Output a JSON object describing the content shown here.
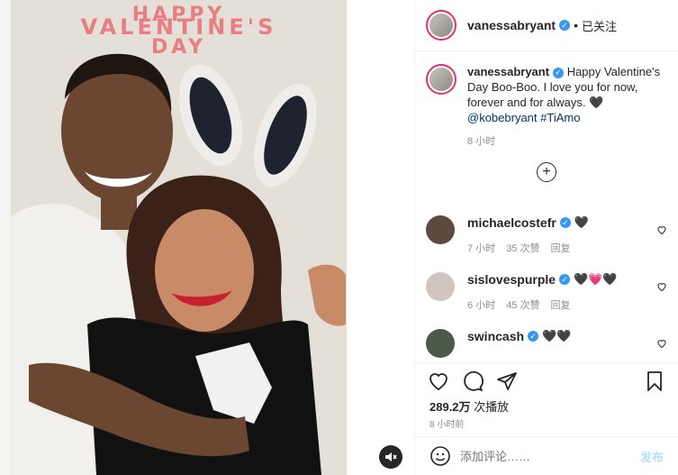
{
  "media": {
    "photo_text": {
      "line1": "HAPPY",
      "line2": "VALENTINE'S",
      "line3": "DAY"
    },
    "mute_icon": "speaker-muted-icon"
  },
  "header": {
    "username": "vanessabryant",
    "separator": "•",
    "follow_label": "已关注"
  },
  "caption": {
    "username": "vanessabryant",
    "text": "Happy Valentine's Day Boo-Boo. I love you for now, forever and for always. 🖤",
    "mention": "@kobebryant",
    "hashtag": "#TiAmo",
    "time": "8 小时"
  },
  "comments": [
    {
      "username": "michaelcostefr",
      "text": "🖤",
      "time": "7 小时",
      "likes": "35 次赞",
      "reply": "回复"
    },
    {
      "username": "sislovespurple",
      "text": "🖤💗🖤",
      "time": "6 小时",
      "likes": "45 次赞",
      "reply": "回复"
    },
    {
      "username": "swincash",
      "text": "🖤🖤",
      "time": "",
      "likes": "",
      "reply": ""
    }
  ],
  "stats": {
    "views": "289.2万",
    "views_label": "次播放",
    "posted": "8 小时前"
  },
  "add_comment": {
    "placeholder": "添加评论……",
    "post_label": "发布"
  },
  "colors": {
    "verified": "#3897f0",
    "link": "#00376b",
    "title_pink": "#e87d83"
  }
}
